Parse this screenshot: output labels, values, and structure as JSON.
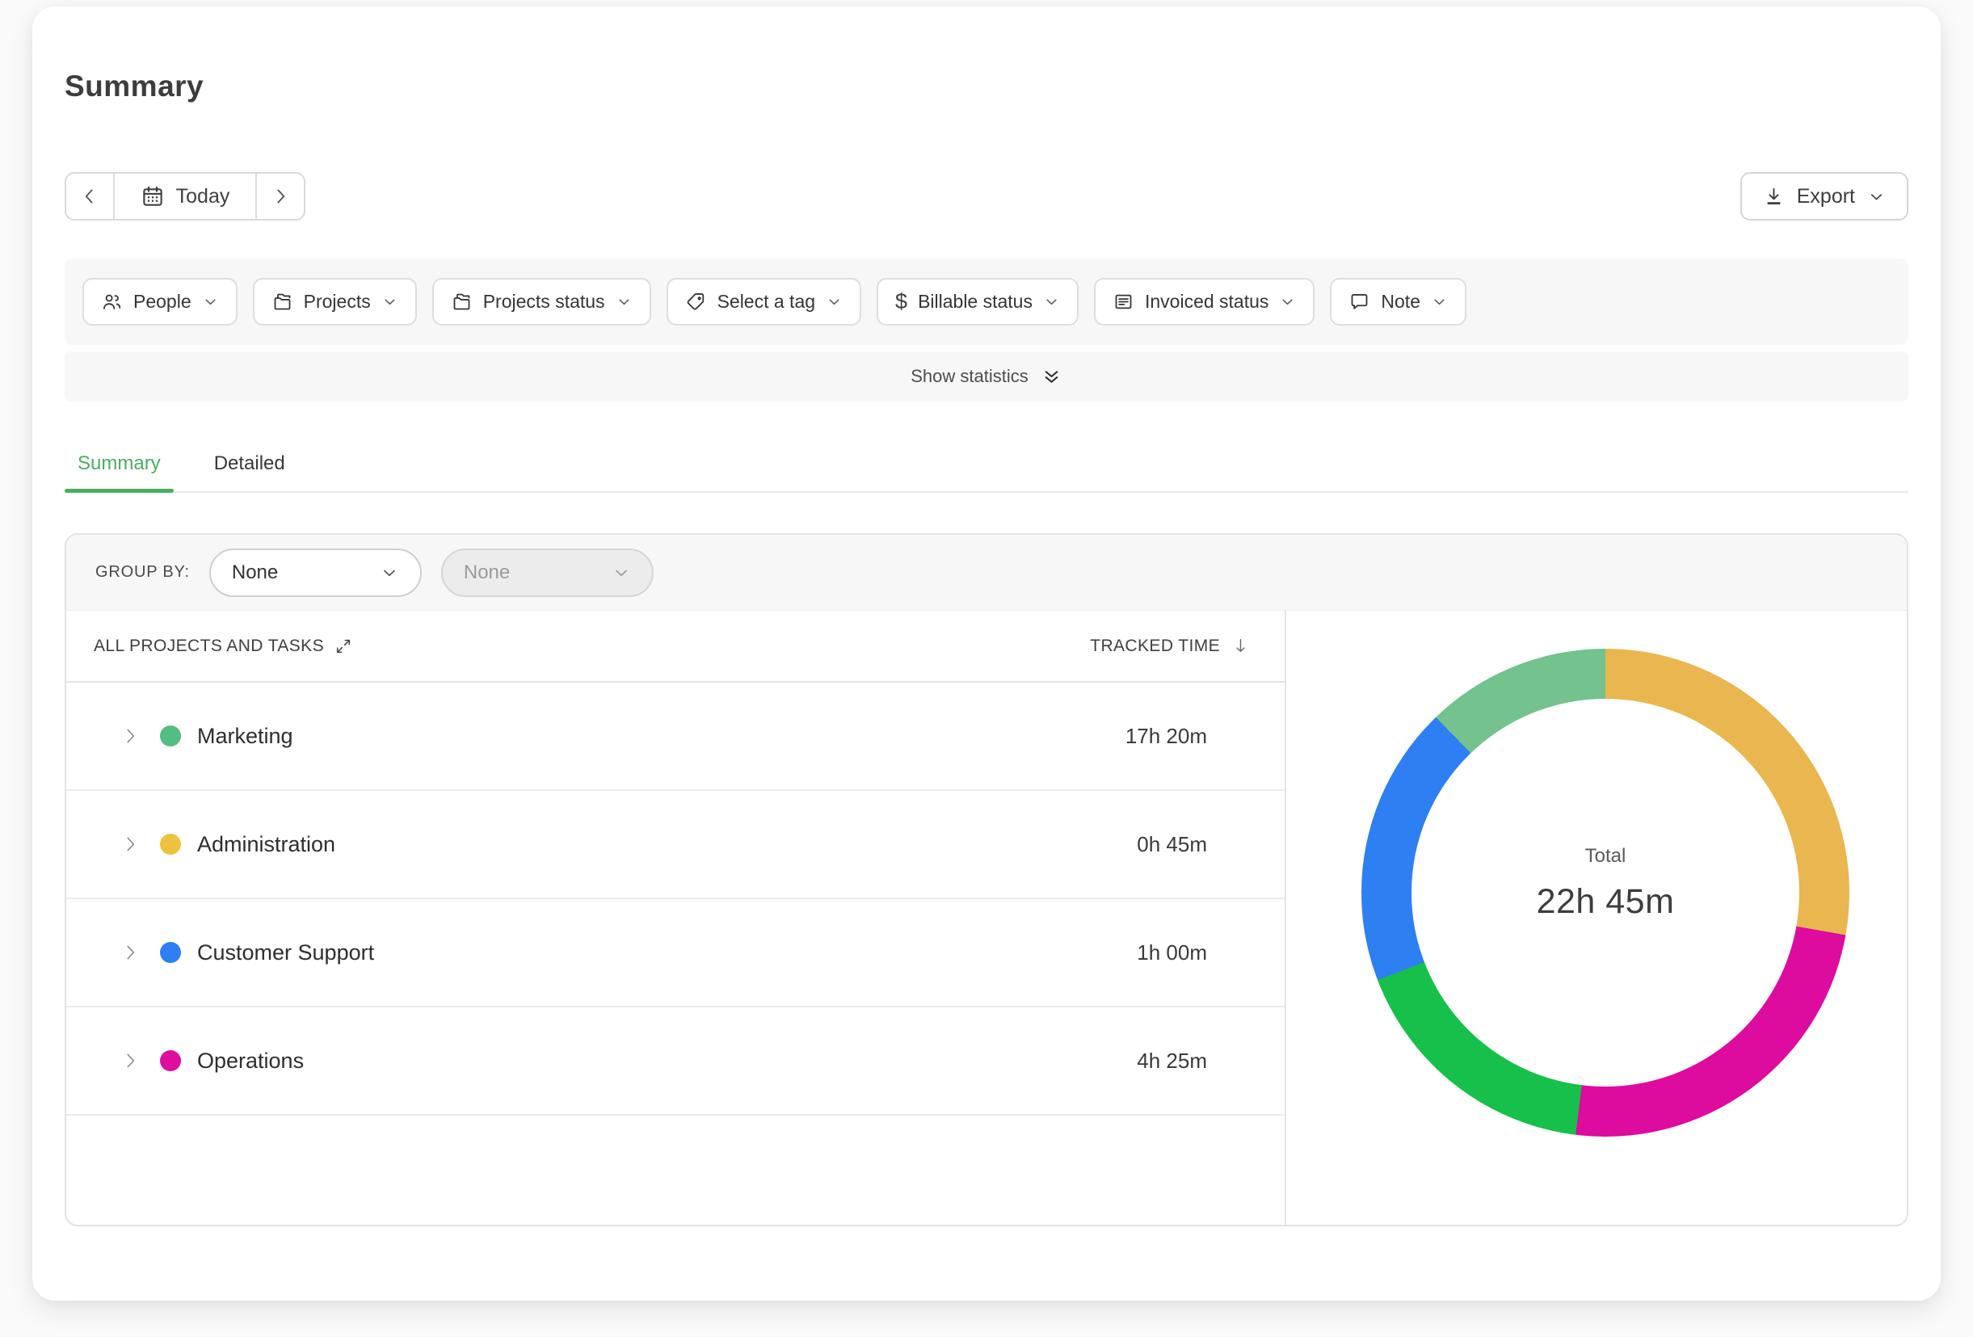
{
  "page": {
    "title": "Summary"
  },
  "toolbar": {
    "today_label": "Today",
    "export_label": "Export"
  },
  "filters": [
    {
      "icon": "people-icon",
      "label": "People"
    },
    {
      "icon": "folder-icon",
      "label": "Projects"
    },
    {
      "icon": "folder-icon",
      "label": "Projects status"
    },
    {
      "icon": "tag-icon",
      "label": "Select a tag"
    },
    {
      "icon": "dollar-icon",
      "label": "Billable status"
    },
    {
      "icon": "invoice-icon",
      "label": "Invoiced status"
    },
    {
      "icon": "note-icon",
      "label": "Note"
    }
  ],
  "statistics": {
    "label": "Show statistics"
  },
  "tabs": [
    {
      "label": "Summary",
      "active": true
    },
    {
      "label": "Detailed",
      "active": false
    }
  ],
  "group_by": {
    "label": "GROUP BY:",
    "primary_value": "None",
    "secondary_value": "None"
  },
  "table": {
    "columns": {
      "name_header": "ALL PROJECTS AND TASKS",
      "time_header": "TRACKED TIME"
    },
    "rows": [
      {
        "name": "Marketing",
        "color": "#52be80",
        "time": "17h 20m"
      },
      {
        "name": "Administration",
        "color": "#eec23e",
        "time": "0h 45m"
      },
      {
        "name": "Customer Support",
        "color": "#2e7ff1",
        "time": "1h 00m"
      },
      {
        "name": "Operations",
        "color": "#e00c9e",
        "time": "4h 25m"
      }
    ]
  },
  "chart_data": {
    "type": "pie",
    "variant": "donut",
    "legend": "none",
    "center": {
      "label": "Total",
      "value": "22h 45m"
    },
    "segments": [
      {
        "color": "#e9b64f",
        "start_deg": 0,
        "end_deg": 100,
        "approx_percent": 27.8
      },
      {
        "color": "#dd0b9e",
        "start_deg": 100,
        "end_deg": 187,
        "approx_percent": 24.2
      },
      {
        "color": "#16c04b",
        "start_deg": 187,
        "end_deg": 249,
        "approx_percent": 17.2
      },
      {
        "color": "#2e7ff1",
        "start_deg": 249,
        "end_deg": 316,
        "approx_percent": 18.6
      },
      {
        "color": "#74c28e",
        "start_deg": 316,
        "end_deg": 360,
        "approx_percent": 12.2
      }
    ]
  },
  "colors": {
    "accent_green": "#4bae60",
    "strip_bg": "#f7f7f7",
    "border": "#e3e3e3"
  },
  "icons": {
    "date_prev": "chevron-left",
    "date_next": "chevron-right",
    "today": "calendar",
    "export": "download",
    "dropdowns": "chevron-down",
    "show_statistics": "double-chevron-down",
    "projects_header": "expand-diagonal-arrows",
    "tracked_time_sort": "arrow-down",
    "row_toggle": "chevron-right"
  }
}
